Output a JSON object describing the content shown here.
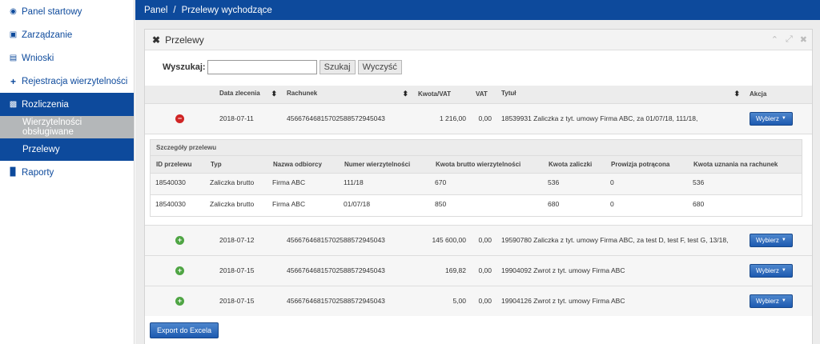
{
  "sidebar": {
    "items": [
      {
        "label": "Panel startowy"
      },
      {
        "label": "Zarządzanie"
      },
      {
        "label": "Wnioski"
      },
      {
        "label": "Rejestracja wierzytelności"
      },
      {
        "label": "Rozliczenia"
      },
      {
        "label": "Wierzytelności obsługiwane"
      },
      {
        "label": "Przelewy"
      },
      {
        "label": "Raporty"
      }
    ]
  },
  "breadcrumb": {
    "root": "Panel",
    "separator": "/",
    "current": "Przelewy wychodzące"
  },
  "panel": {
    "title": "Przelewy"
  },
  "search": {
    "label": "Wyszukaj:",
    "value": "",
    "search_button": "Szukaj",
    "clear_button": "Wyczyść"
  },
  "table": {
    "headers": [
      "Data zlecenia",
      "Rachunek",
      "Kwota/VAT",
      "VAT",
      "Tytuł",
      "Akcja"
    ],
    "action_label": "Wybierz",
    "rows": [
      {
        "date": "2018-07-11",
        "account": "45667646815702588572945043",
        "amount": "1 216,00",
        "vat": "0,00",
        "title": "18539931 Zaliczka z tyt. umowy Firma ABC, za 01/07/18, 111/18,"
      },
      {
        "date": "2018-07-12",
        "account": "45667646815702588572945043",
        "amount": "145 600,00",
        "vat": "0,00",
        "title": "19590780 Zaliczka z tyt. umowy Firma ABC, za test D, test F, test G, 13/18,"
      },
      {
        "date": "2018-07-15",
        "account": "45667646815702588572945043",
        "amount": "169,82",
        "vat": "0,00",
        "title": "19904092 Zwrot z tyt. umowy Firma ABC"
      },
      {
        "date": "2018-07-15",
        "account": "45667646815702588572945043",
        "amount": "5,00",
        "vat": "0,00",
        "title": "19904126 Zwrot z tyt. umowy Firma ABC"
      }
    ]
  },
  "details": {
    "title": "Szczegóły przelewu",
    "headers": [
      "ID przelewu",
      "Typ",
      "Nazwa odbiorcy",
      "Numer wierzytelności",
      "Kwota brutto wierzytelności",
      "Kwota zaliczki",
      "Prowizja potrącona",
      "Kwota uznania na rachunek"
    ],
    "rows": [
      [
        "18540030",
        "Zaliczka brutto",
        "Firma ABC",
        "111/18",
        "670",
        "536",
        "0",
        "536"
      ],
      [
        "18540030",
        "Zaliczka brutto",
        "Firma ABC",
        "01/07/18",
        "850",
        "680",
        "0",
        "680"
      ]
    ]
  },
  "export_button": "Export do Excela",
  "colors": {
    "brand": "#0d4a9c",
    "selected_sub": "#b4b7b9",
    "minus": "#d02525",
    "plus": "#4fa544"
  }
}
